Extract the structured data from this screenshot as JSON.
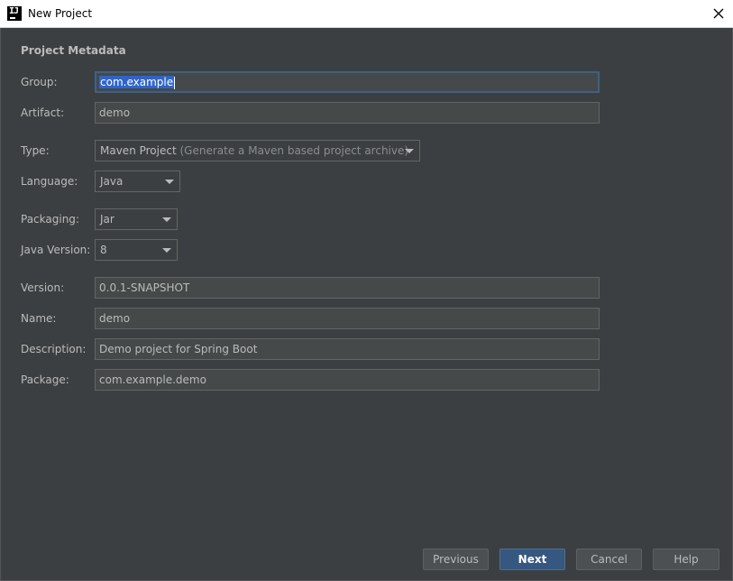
{
  "window": {
    "title": "New Project",
    "close_icon": "close-icon",
    "app_icon": "intellij-idea-icon"
  },
  "section": {
    "title": "Project Metadata"
  },
  "fields": {
    "group": {
      "label": "Group:",
      "value": "com.example"
    },
    "artifact": {
      "label": "Artifact:",
      "value": "demo"
    },
    "type": {
      "label": "Type:",
      "value": "Maven Project",
      "hint": "(Generate a Maven based project archive)"
    },
    "language": {
      "label": "Language:",
      "value": "Java"
    },
    "packaging": {
      "label": "Packaging:",
      "value": "Jar"
    },
    "java_version": {
      "label": "Java Version:",
      "value": "8"
    },
    "version": {
      "label": "Version:",
      "value": "0.0.1-SNAPSHOT"
    },
    "name": {
      "label": "Name:",
      "value": "demo"
    },
    "description": {
      "label": "Description:",
      "value": "Demo project for Spring Boot"
    },
    "package": {
      "label": "Package:",
      "value": "com.example.demo"
    }
  },
  "buttons": {
    "previous": "Previous",
    "next": "Next",
    "cancel": "Cancel",
    "help": "Help"
  },
  "colors": {
    "background": "#3c3f41",
    "field_background": "#45494a",
    "default_button": "#365880",
    "selection": "#2f65ca"
  }
}
